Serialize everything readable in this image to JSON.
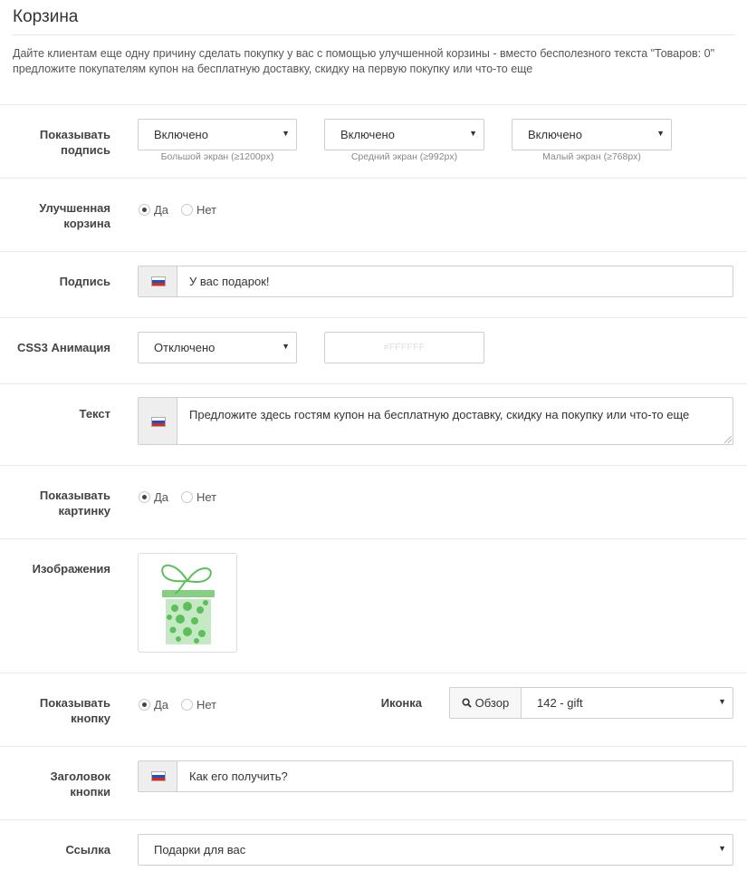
{
  "page": {
    "title": "Корзина",
    "intro": "Дайте клиентам еще одну причину сделать покупку у вас с помощью улучшенной корзины - вместо бесполезного текста \"Товаров: 0\" предложите покупателям купон на бесплатную доставку, скидку на первую покупку или что-то еще"
  },
  "show_caption": {
    "label_1": "Показывать",
    "label_2": "подпись",
    "large": {
      "value": "Включено",
      "hint": "Большой экран (≥1200px)"
    },
    "medium": {
      "value": "Включено",
      "hint": "Средний экран (≥992px)"
    },
    "small": {
      "value": "Включено",
      "hint": "Малый экран (≥768px)"
    }
  },
  "improved_cart": {
    "label_1": "Улучшенная",
    "label_2": "корзина",
    "yes": "Да",
    "no": "Нет",
    "selected": "yes"
  },
  "caption": {
    "label": "Подпись",
    "value": "У вас подарок!"
  },
  "animation": {
    "label": "CSS3 Анимация",
    "value": "Отключено",
    "color": "#FFFFFF"
  },
  "text": {
    "label": "Текст",
    "value": "Предложите здесь гостям купон на бесплатную доставку, скидку на покупку или что-то еще"
  },
  "show_image": {
    "label_1": "Показывать",
    "label_2": "картинку",
    "yes": "Да",
    "no": "Нет",
    "selected": "yes"
  },
  "images": {
    "label": "Изображения",
    "icon": "gift-image"
  },
  "show_button": {
    "label_1": "Показывать",
    "label_2": "кнопку",
    "yes": "Да",
    "no": "Нет",
    "selected": "yes",
    "icon_label": "Иконка",
    "browse": "Обзор",
    "icon_value": "142 - gift"
  },
  "button_title": {
    "label_1": "Заголовок",
    "label_2": "кнопки",
    "value": "Как его получить?"
  },
  "link": {
    "label": "Ссылка",
    "value": "Подарки для вас"
  },
  "colors": {
    "border": "#cfcfcf",
    "addon": "#eeeeee",
    "gift_green": "#5cbf5a"
  }
}
